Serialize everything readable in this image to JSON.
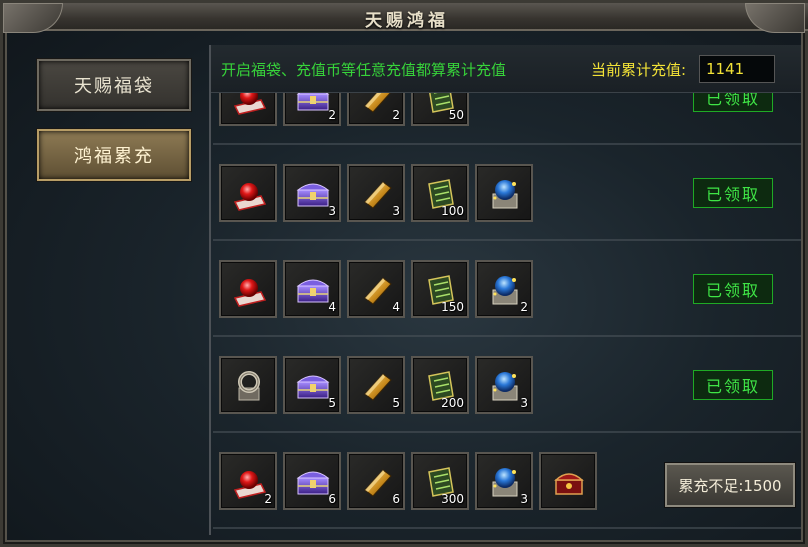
{
  "window": {
    "title": "天赐鸿福"
  },
  "sidebar": {
    "items": [
      {
        "label": "天赐福袋",
        "active": false
      },
      {
        "label": "鸿福累充",
        "active": true
      }
    ]
  },
  "banner": {
    "note": "开启福袋、充值币等任意充值都算累计充值",
    "current_label": "当前累计充值:",
    "current_value": "1141"
  },
  "rows": [
    {
      "items": [
        {
          "icon": "red-orb-icon",
          "count": ""
        },
        {
          "icon": "purple-chest-icon",
          "count": "2"
        },
        {
          "icon": "gold-bar-icon",
          "count": "2"
        },
        {
          "icon": "scroll-icon",
          "count": "50"
        }
      ],
      "status": "已领取"
    },
    {
      "items": [
        {
          "icon": "red-orb-icon",
          "count": ""
        },
        {
          "icon": "purple-chest-icon",
          "count": "3"
        },
        {
          "icon": "gold-bar-icon",
          "count": "3"
        },
        {
          "icon": "scroll-icon",
          "count": "100"
        },
        {
          "icon": "blue-crystal-icon",
          "count": ""
        }
      ],
      "status": "已领取"
    },
    {
      "items": [
        {
          "icon": "red-orb-icon",
          "count": ""
        },
        {
          "icon": "purple-chest-icon",
          "count": "4"
        },
        {
          "icon": "gold-bar-icon",
          "count": "4"
        },
        {
          "icon": "scroll-icon",
          "count": "150"
        },
        {
          "icon": "blue-crystal-icon",
          "count": "2"
        }
      ],
      "status": "已领取"
    },
    {
      "items": [
        {
          "icon": "silver-ring-icon",
          "count": ""
        },
        {
          "icon": "purple-chest-icon",
          "count": "5"
        },
        {
          "icon": "gold-bar-icon",
          "count": "5"
        },
        {
          "icon": "scroll-icon",
          "count": "200"
        },
        {
          "icon": "blue-crystal-icon",
          "count": "3"
        }
      ],
      "status": "已领取"
    },
    {
      "items": [
        {
          "icon": "red-orb-icon",
          "count": "2"
        },
        {
          "icon": "purple-chest-icon",
          "count": "6"
        },
        {
          "icon": "gold-bar-icon",
          "count": "6"
        },
        {
          "icon": "scroll-icon",
          "count": "300"
        },
        {
          "icon": "blue-crystal-icon",
          "count": "3"
        },
        {
          "icon": "red-treasure-icon",
          "count": ""
        }
      ],
      "status": "累充不足:1500"
    }
  ],
  "colors": {
    "accent_green": "#37d33a",
    "accent_yellow": "#f2e237",
    "active_tab": "#8d7a54"
  }
}
